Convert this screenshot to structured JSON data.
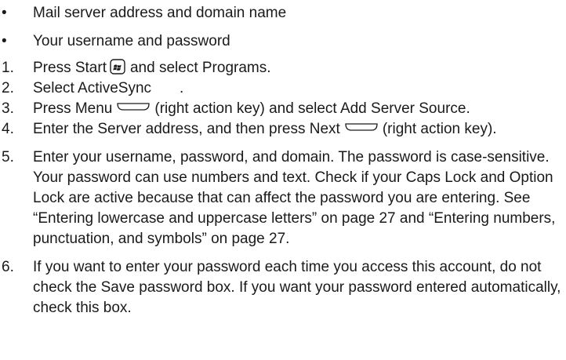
{
  "bullets": [
    "Mail server address and domain name",
    "Your username and password"
  ],
  "bullet_mark": "•",
  "steps": [
    {
      "num": "1.",
      "a": "Press Start",
      "icon": "windows-start-icon",
      "b": "and select Programs."
    },
    {
      "num": "2.",
      "a": "Select ActiveSync",
      "b": "."
    },
    {
      "num": "3.",
      "a": "Press Menu",
      "icon": "right-action-key-icon",
      "b": "(right action key) and select Add Server Source."
    },
    {
      "num": "4.",
      "a": "Enter the Server address, and then press Next",
      "icon": "right-action-key-icon",
      "b": "(right action key)."
    },
    {
      "num": "5.",
      "text": "Enter your username, password, and domain. The password is case-sensitive. Your password can use numbers and text. Check if your Caps Lock and Option Lock are active because that can affect the password you are entering. See “Entering lowercase and uppercase letters” on page 27 and “Entering numbers, punctuation, and symbols” on page 27."
    },
    {
      "num": "6.",
      "text": "If you want to enter your password each time you access this account, do not check the Save password box. If you want your password entered automatically, check this box."
    }
  ]
}
